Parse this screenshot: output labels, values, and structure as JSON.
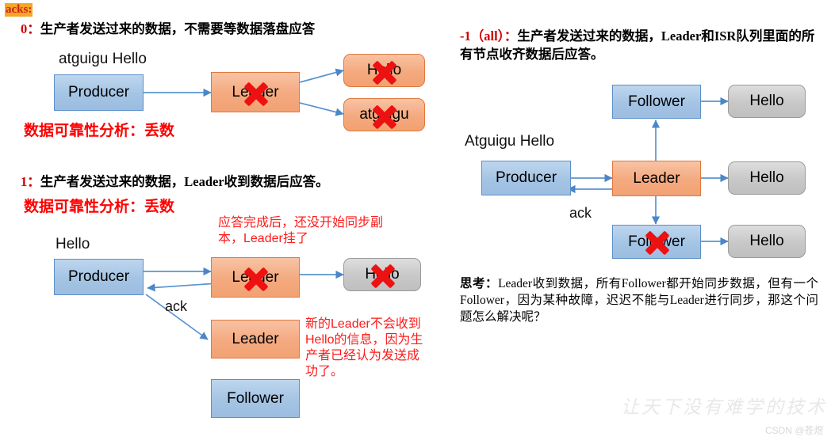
{
  "page": {
    "top_label": "acks:"
  },
  "sections": {
    "ack0": {
      "heading_num": "0：",
      "heading_text": "生产者发送过来的数据，不需要等数据落盘应答",
      "analysis": "数据可靠性分析：丢数",
      "producer_msg": "atguigu  Hello",
      "nodes": {
        "producer": "Producer",
        "leader": "Leader",
        "out_top": "Hello",
        "out_bottom": "atguigu"
      }
    },
    "ack1": {
      "heading_num": "1：",
      "heading_text": "生产者发送过来的数据，Leader收到数据后应答。",
      "analysis": "数据可靠性分析：丢数",
      "producer_msg": "Hello",
      "ack_label": "ack",
      "note_top": "应答完成后，还没开始同步副本，Leader挂了",
      "note_right": "新的Leader不会收到Hello的信息，因为生产者已经认为发送成功了。",
      "nodes": {
        "producer": "Producer",
        "leader": "Leader",
        "stored": "Hello",
        "new_leader": "Leader",
        "follower": "Follower"
      }
    },
    "ackall": {
      "heading_num": "-1（all）：",
      "heading_text": "生产者发送过来的数据，Leader和ISR队列里面的所有节点收齐数据后应答。",
      "producer_msg": "Atguigu Hello",
      "ack_label": "ack",
      "nodes": {
        "producer": "Producer",
        "leader": "Leader",
        "follower_top": "Follower",
        "follower_bottom": "Follower",
        "hello_top": "Hello",
        "hello_mid": "Hello",
        "hello_bottom": "Hello"
      },
      "think_label": "思考：",
      "think_text": "Leader收到数据，所有Follower都开始同步数据，但有一个Follower，因为某种故障，迟迟不能与Leader进行同步，那这个问题怎么解决呢？"
    }
  },
  "watermark": {
    "script": "让天下没有难学的技术",
    "csdn": "CSDN @苍煜"
  },
  "colors": {
    "accent_red": "#ff0000",
    "highlight_orange": "#f5a623",
    "node_blue": "#a4c4e4",
    "node_orange": "#f4a97f",
    "node_gray": "#c8c8c8",
    "arrow_blue": "#4a86c8"
  }
}
